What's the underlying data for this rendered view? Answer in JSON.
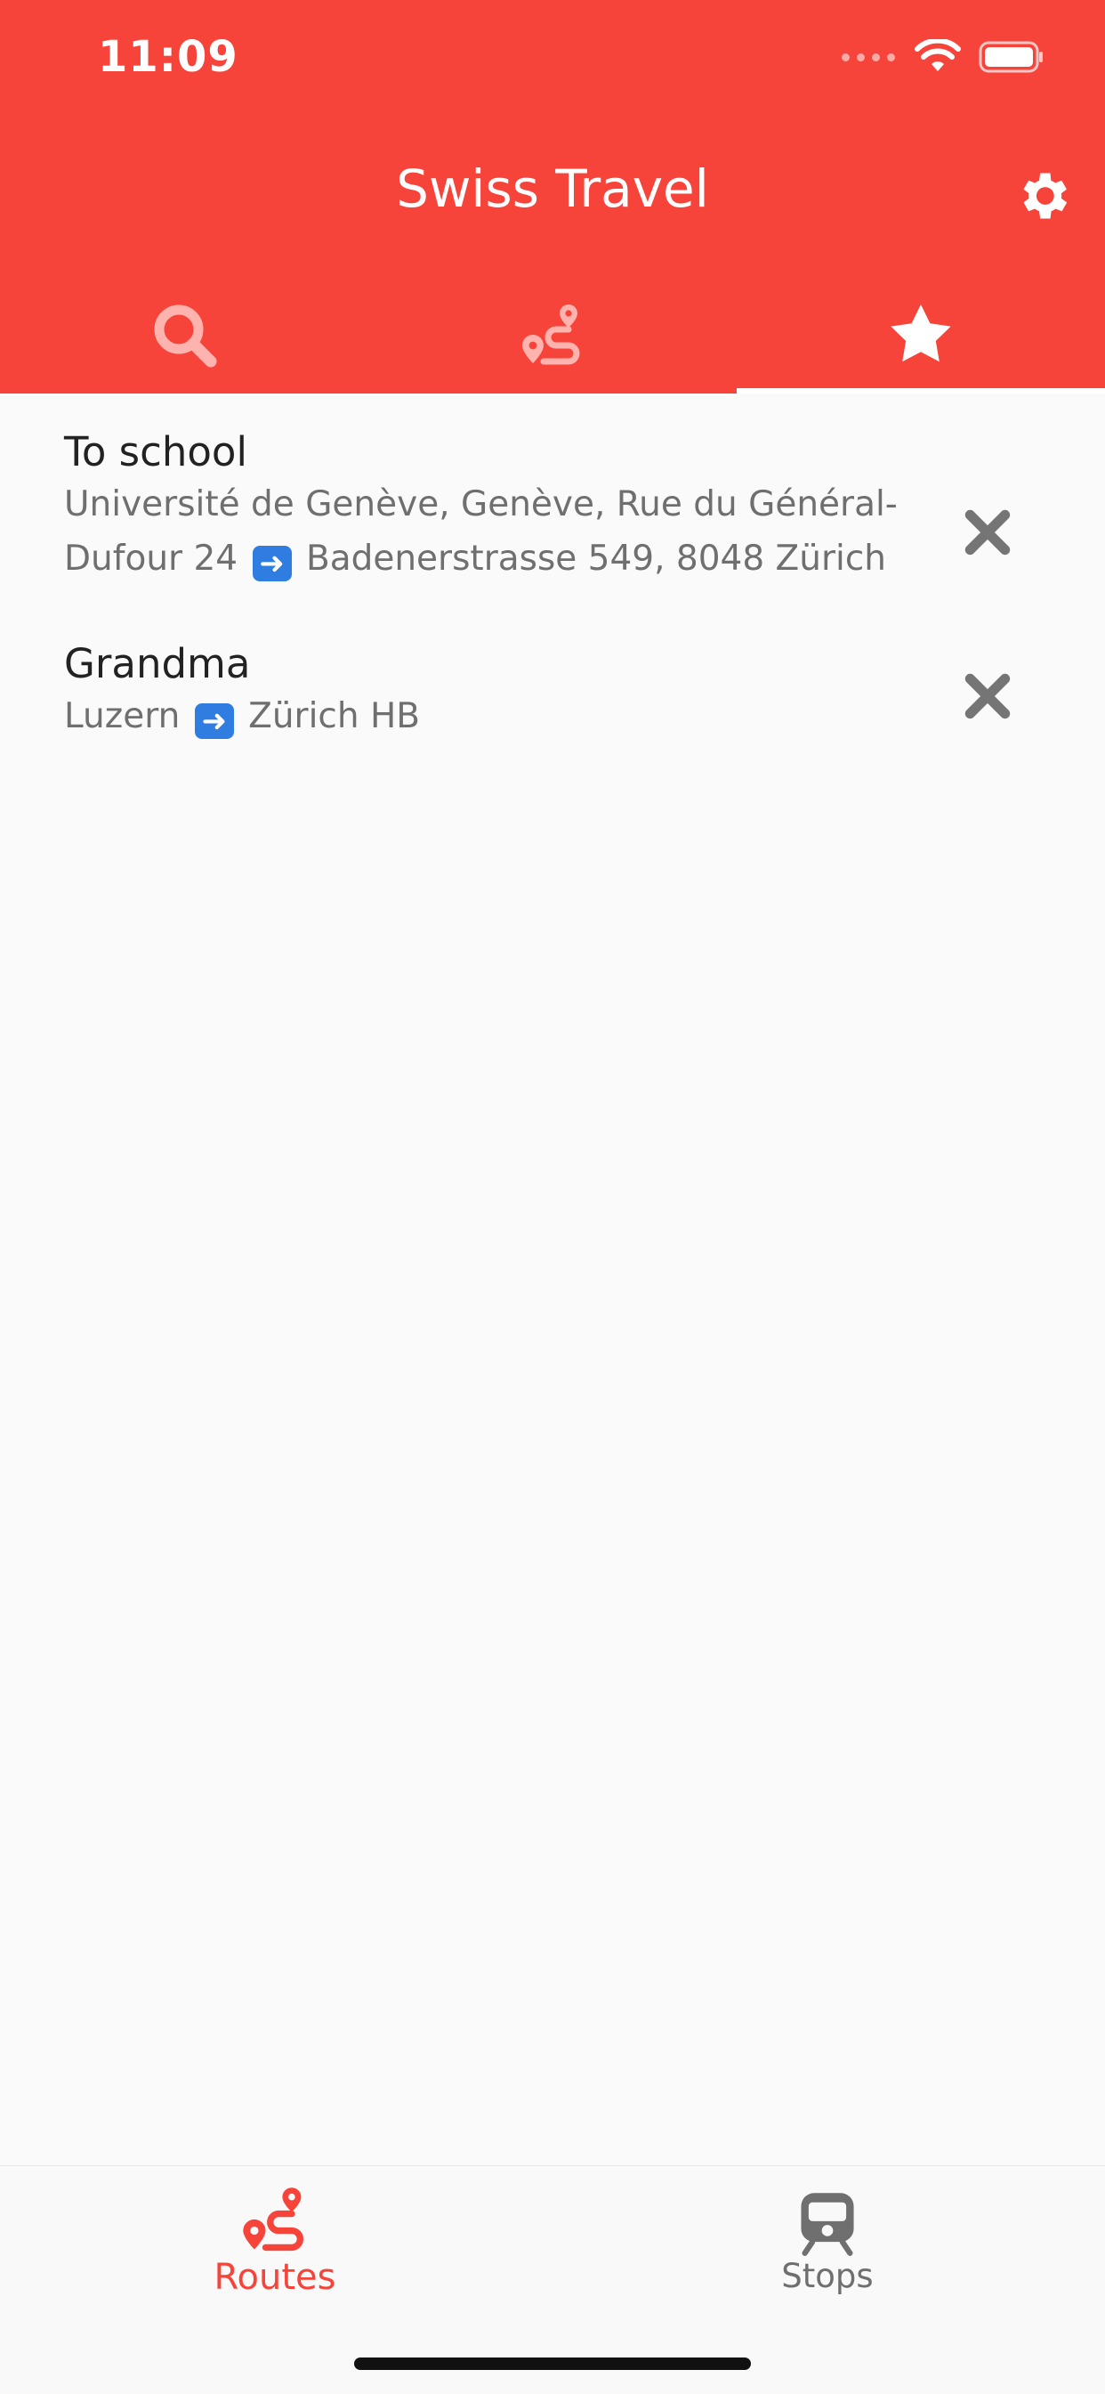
{
  "status": {
    "time": "11:09"
  },
  "app": {
    "title": "Swiss Travel"
  },
  "tabs": [
    {
      "icon": "search-icon"
    },
    {
      "icon": "route-icon"
    },
    {
      "icon": "star-icon",
      "selected": true
    }
  ],
  "favorites": [
    {
      "name": "To school",
      "from": "Université de Genève, Genève, Rue du Général-Dufour 24",
      "to": "Badenerstrasse 549, 8048 Zürich"
    },
    {
      "name": "Grandma",
      "from": "Luzern",
      "to": "Zürich HB"
    }
  ],
  "bottom_nav": {
    "routes": "Routes",
    "stops": "Stops"
  },
  "colors": {
    "accent": "#f6443b",
    "inactive": "#6f6f6f"
  }
}
